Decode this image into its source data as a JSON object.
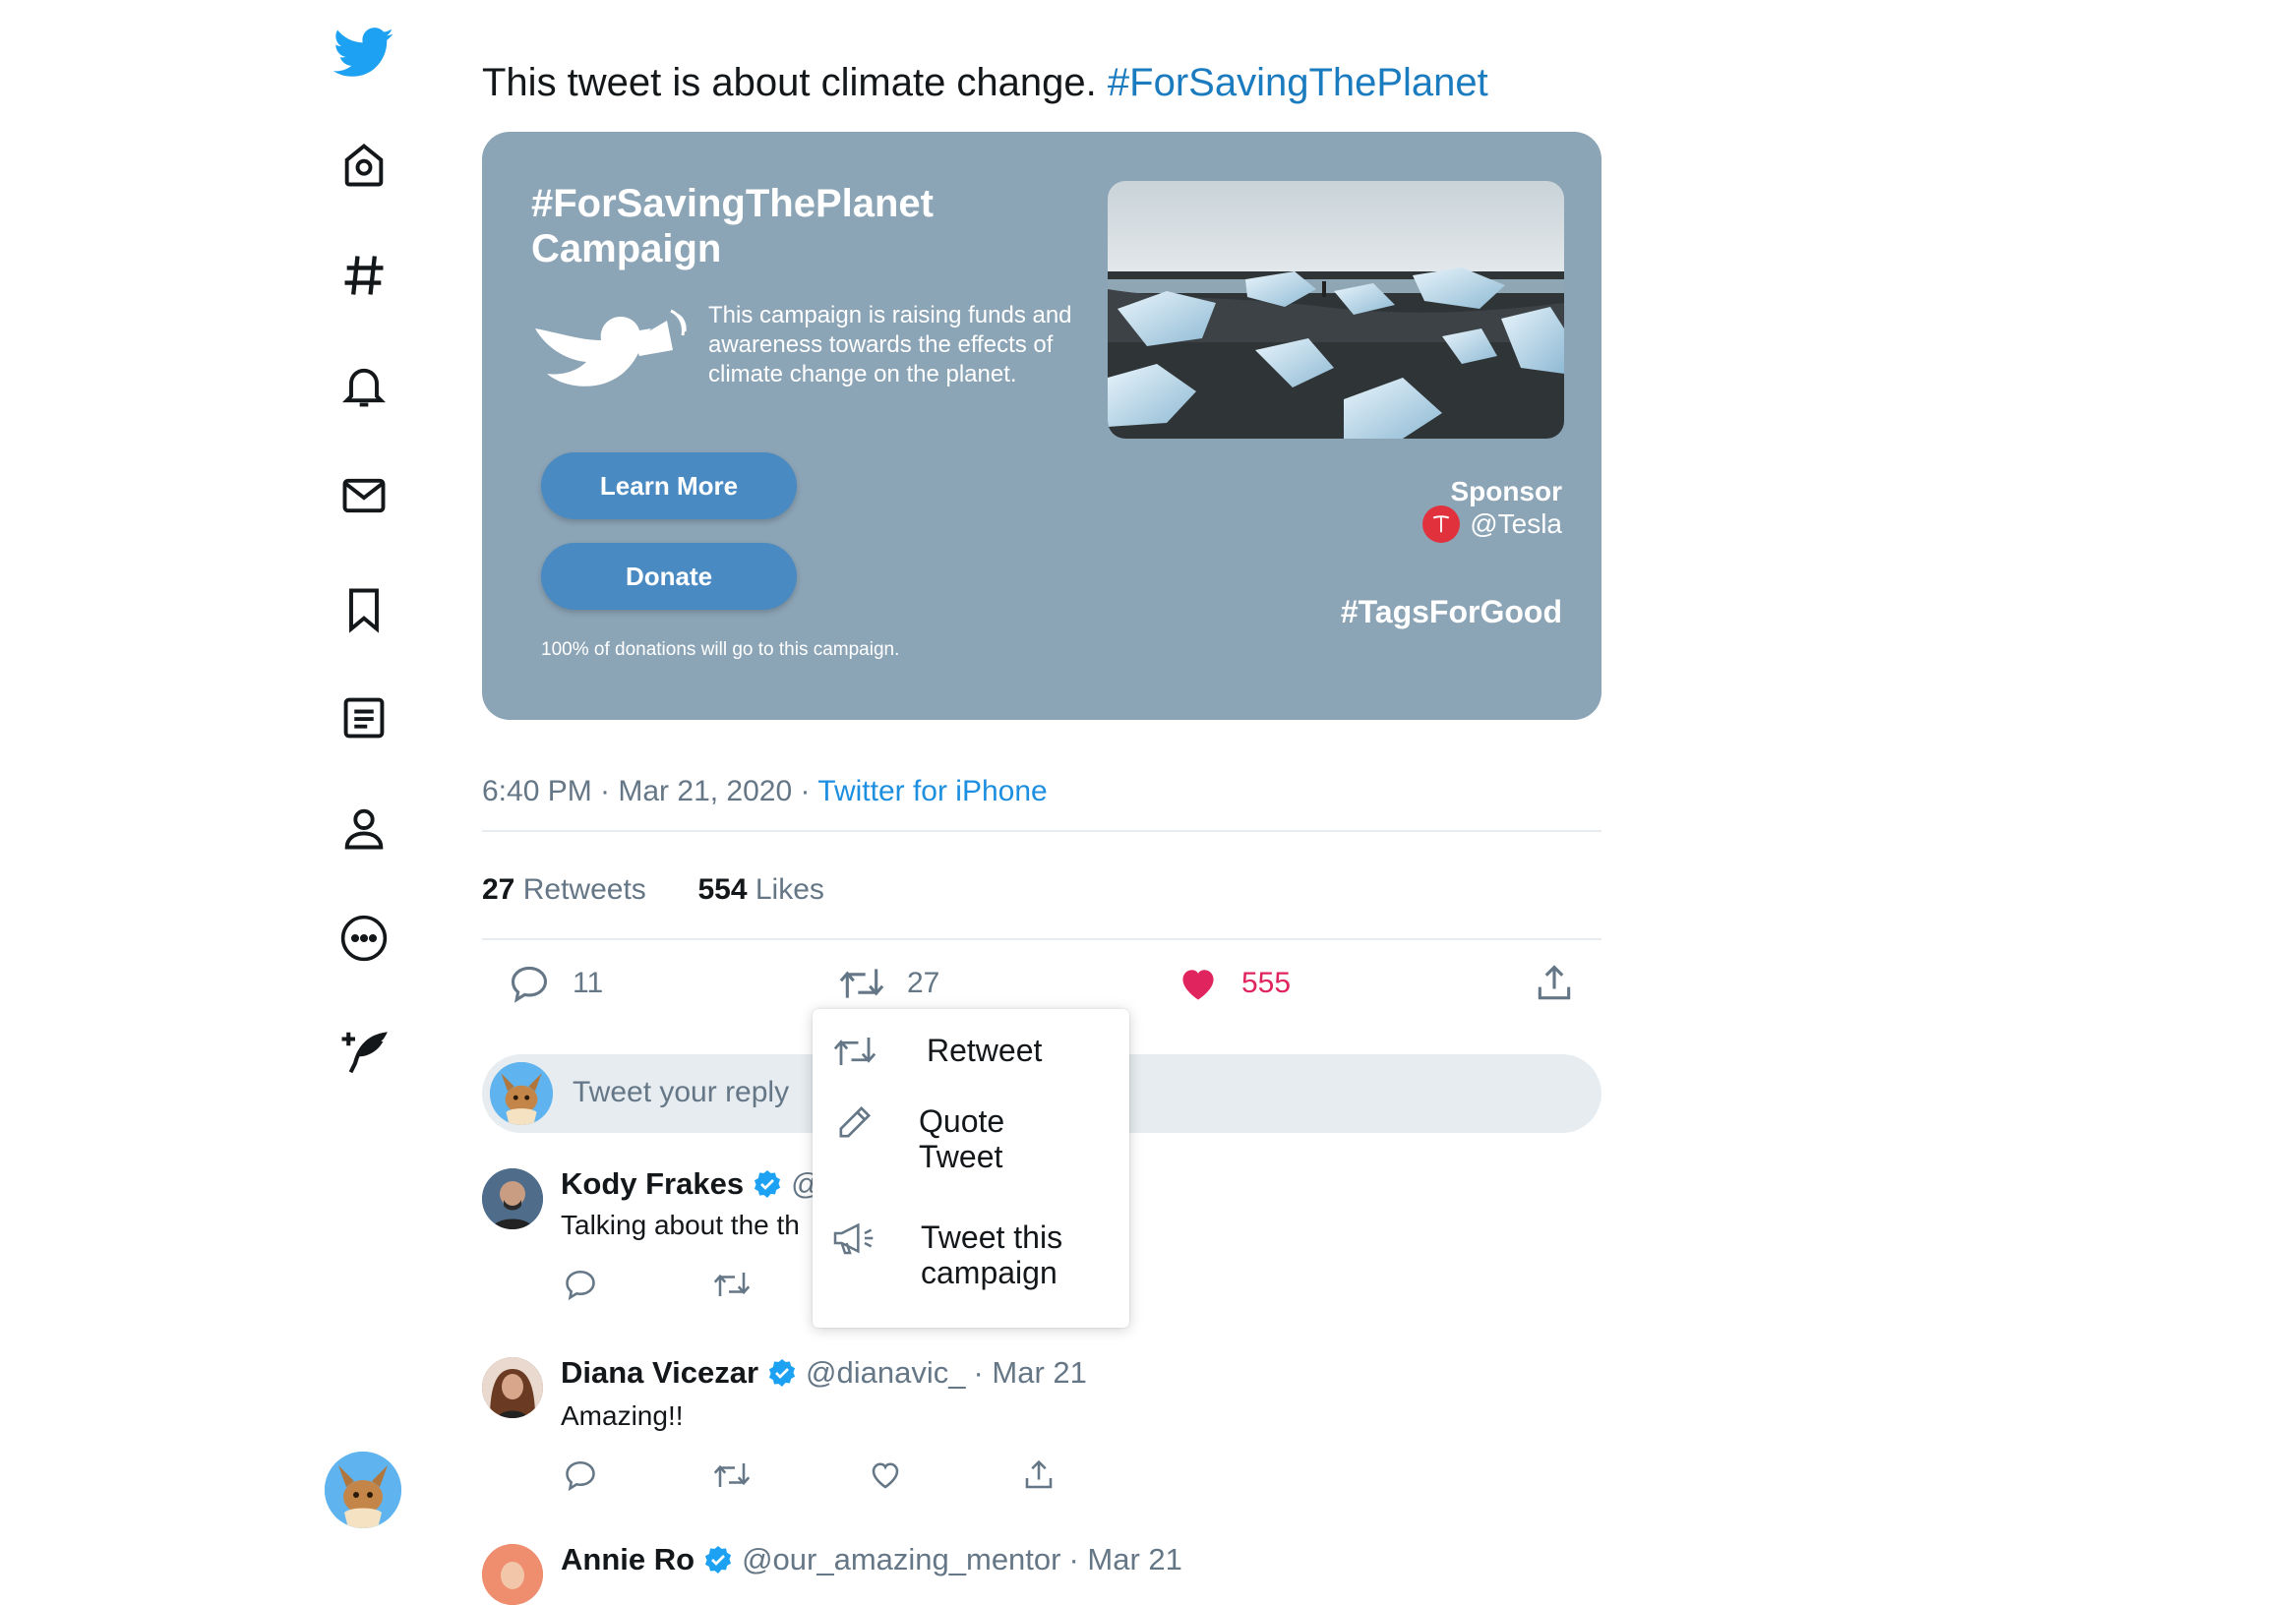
{
  "tweet": {
    "text": "This tweet is about climate change. ",
    "hashtag": "#ForSavingThePlanet"
  },
  "card": {
    "title_line1": "#ForSavingThePlanet",
    "title_line2": "Campaign",
    "description": "This campaign is raising funds and awareness towards the effects of climate change on the planet.",
    "learn_more": "Learn More",
    "donate": "Donate",
    "note": "100% of donations will go to this campaign.",
    "sponsor_label": "Sponsor",
    "sponsor_handle": "@Tesla",
    "tag": "#TagsForGood"
  },
  "meta": {
    "time": "6:40 PM · Mar 21, 2020 · ",
    "source": "Twitter for iPhone"
  },
  "stats": {
    "retweets_count": "27",
    "retweets_label": "Retweets",
    "likes_count": "554",
    "likes_label": "Likes"
  },
  "actions": {
    "replies": "11",
    "retweets": "27",
    "likes": "555"
  },
  "reply_box": {
    "placeholder": "Tweet your reply"
  },
  "menu": {
    "retweet": "Retweet",
    "quote_line1": "Quote",
    "quote_line2": "Tweet",
    "campaign_line1": "Tweet this",
    "campaign_line2": "campaign"
  },
  "replies": [
    {
      "name": "Kody Frakes",
      "handle": "@",
      "date": "",
      "text": "Talking about the th"
    },
    {
      "name": "Diana Vicezar",
      "handle": "@dianavic_",
      "date": "· Mar 21",
      "text": "Amazing!!"
    },
    {
      "name": "Annie Ro",
      "handle": "@our_amazing_mentor",
      "date": "· Mar 21",
      "text": ""
    }
  ],
  "colors": {
    "accent": "#1da1f2",
    "card_bg": "#8ba4b6",
    "button": "#4a8ac2",
    "like": "#e0245e",
    "tesla": "#e0313d"
  },
  "icons": {
    "nav": [
      "twitter-logo-icon",
      "home-icon",
      "hashtag-icon",
      "bell-icon",
      "mail-icon",
      "bookmark-icon",
      "list-icon",
      "profile-icon",
      "more-icon",
      "compose-icon"
    ]
  }
}
